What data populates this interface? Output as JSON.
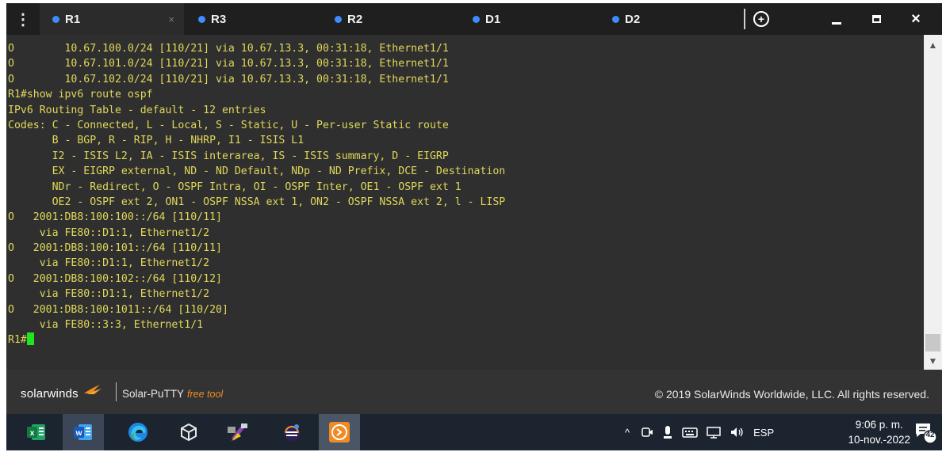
{
  "tabs": [
    {
      "label": "R1",
      "active": true,
      "close": "×"
    },
    {
      "label": "R3"
    },
    {
      "label": "R2"
    },
    {
      "label": "D1"
    },
    {
      "label": "D2"
    }
  ],
  "menu_glyph": "⋮",
  "window_controls": {
    "close": "×"
  },
  "terminal": {
    "lines": [
      "O        10.67.100.0/24 [110/21] via 10.67.13.3, 00:31:18, Ethernet1/1",
      "O        10.67.101.0/24 [110/21] via 10.67.13.3, 00:31:18, Ethernet1/1",
      "O        10.67.102.0/24 [110/21] via 10.67.13.3, 00:31:18, Ethernet1/1",
      "R1#show ipv6 route ospf",
      "IPv6 Routing Table - default - 12 entries",
      "Codes: C - Connected, L - Local, S - Static, U - Per-user Static route",
      "       B - BGP, R - RIP, H - NHRP, I1 - ISIS L1",
      "       I2 - ISIS L2, IA - ISIS interarea, IS - ISIS summary, D - EIGRP",
      "       EX - EIGRP external, ND - ND Default, NDp - ND Prefix, DCE - Destination",
      "       NDr - Redirect, O - OSPF Intra, OI - OSPF Inter, OE1 - OSPF ext 1",
      "       OE2 - OSPF ext 2, ON1 - OSPF NSSA ext 1, ON2 - OSPF NSSA ext 2, l - LISP",
      "O   2001:DB8:100:100::/64 [110/11]",
      "     via FE80::D1:1, Ethernet1/2",
      "O   2001:DB8:100:101::/64 [110/11]",
      "     via FE80::D1:1, Ethernet1/2",
      "O   2001:DB8:100:102::/64 [110/12]",
      "     via FE80::D1:1, Ethernet1/2",
      "O   2001:DB8:100:1011::/64 [110/20]",
      "     via FE80::3:3, Ethernet1/1"
    ],
    "prompt": "R1#",
    "text_color": "#e0d85a",
    "cursor_color": "#1ee61e"
  },
  "footer": {
    "logo": "solarwinds",
    "product": "Solar-PuTTY",
    "product_suffix": "free tool",
    "copyright": "© 2019 SolarWinds Worldwide, LLC. All rights reserved."
  },
  "taskbar": {
    "apps": [
      "excel-icon",
      "word-icon",
      "edge-icon",
      "virtualbox-icon",
      "gns3-icon",
      "eclipse-icon",
      "solar-putty-icon"
    ],
    "tray": {
      "chevron": "^",
      "language": "ESP"
    },
    "clock": {
      "time": "9:06 p. m.",
      "date": "10-nov.-2022"
    },
    "notifications": "42"
  },
  "colors": {
    "accent_dot": "#3f8cff",
    "terminal_bg": "#2f2f2f",
    "footer_bg": "#333333",
    "taskbar_bg": "#1c2430"
  }
}
